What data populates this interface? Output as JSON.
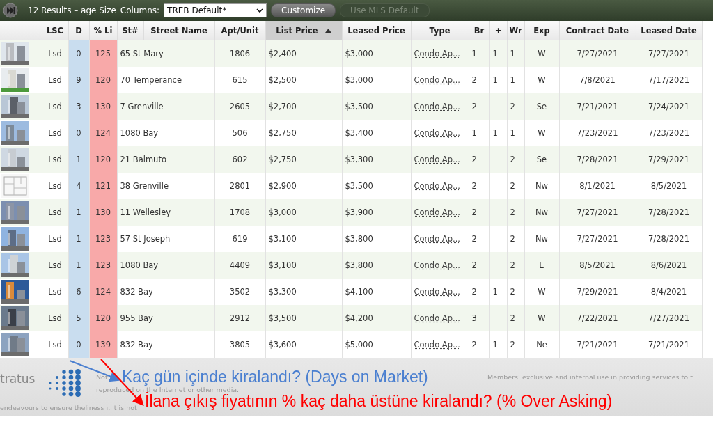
{
  "toolbar": {
    "results": "12 Results – age Size",
    "columns_label": "Columns:",
    "columns_value": "TREB Default*",
    "buttons": [
      {
        "label": "Customize",
        "disabled": false
      },
      {
        "label": "Use MLS Default",
        "disabled": true
      }
    ]
  },
  "table": {
    "columns": [
      {
        "label": "LSC",
        "sorted": false
      },
      {
        "label": "D",
        "sorted": false
      },
      {
        "label": "% Li",
        "sorted": false
      },
      {
        "label": "St#",
        "sorted": false
      },
      {
        "label": "Street Name",
        "sorted": false
      },
      {
        "label": "Apt/Unit",
        "sorted": false
      },
      {
        "label": "List Price",
        "sorted": true
      },
      {
        "label": "Leased Price",
        "sorted": false
      },
      {
        "label": "Type",
        "sorted": false
      },
      {
        "label": "Br",
        "sorted": false
      },
      {
        "label": "+",
        "sorted": false
      },
      {
        "label": "Wr",
        "sorted": false
      },
      {
        "label": "Exp",
        "sorted": false
      },
      {
        "label": "Contract Date",
        "sorted": false
      },
      {
        "label": "Leased Date",
        "sorted": false
      }
    ],
    "rows": [
      {
        "lsc": "Lsd",
        "d": "0",
        "pct": "125",
        "street": "65 St Mary",
        "apt": "1806",
        "list": "$2,400",
        "leased": "$3,000",
        "type": "Condo Ap...",
        "br": "1",
        "plus": "1",
        "wr": "1",
        "exp": "W",
        "contract": "7/27/2021",
        "leased_date": "7/27/2021"
      },
      {
        "lsc": "Lsd",
        "d": "9",
        "pct": "120",
        "street": "70 Temperance",
        "apt": "615",
        "list": "$2,500",
        "leased": "$3,000",
        "type": "Condo Ap...",
        "br": "2",
        "plus": "1",
        "wr": "1",
        "exp": "W",
        "contract": "7/8/2021",
        "leased_date": "7/17/2021"
      },
      {
        "lsc": "Lsd",
        "d": "3",
        "pct": "130",
        "street": "7 Grenville",
        "apt": "2605",
        "list": "$2,700",
        "leased": "$3,500",
        "type": "Condo Ap...",
        "br": "2",
        "wr": "2",
        "exp": "Se",
        "contract": "7/21/2021",
        "leased_date": "7/24/2021"
      },
      {
        "lsc": "Lsd",
        "d": "0",
        "pct": "124",
        "street": "1080 Bay",
        "apt": "506",
        "list": "$2,750",
        "leased": "$3,400",
        "type": "Condo Ap...",
        "br": "1",
        "plus": "1",
        "wr": "1",
        "exp": "W",
        "contract": "7/23/2021",
        "leased_date": "7/23/2021"
      },
      {
        "lsc": "Lsd",
        "d": "1",
        "pct": "120",
        "street": "21 Balmuto",
        "apt": "602",
        "list": "$2,750",
        "leased": "$3,300",
        "type": "Condo Ap...",
        "br": "2",
        "wr": "2",
        "exp": "Se",
        "contract": "7/28/2021",
        "leased_date": "7/29/2021"
      },
      {
        "lsc": "Lsd",
        "d": "4",
        "pct": "121",
        "street": "38 Grenville",
        "apt": "2801",
        "list": "$2,900",
        "leased": "$3,500",
        "type": "Condo Ap...",
        "br": "2",
        "wr": "2",
        "exp": "Nw",
        "contract": "8/1/2021",
        "leased_date": "8/5/2021"
      },
      {
        "lsc": "Lsd",
        "d": "1",
        "pct": "130",
        "street": "11 Wellesley",
        "apt": "1708",
        "list": "$3,000",
        "leased": "$3,900",
        "type": "Condo Ap...",
        "br": "2",
        "wr": "2",
        "exp": "Nw",
        "contract": "7/27/2021",
        "leased_date": "7/28/2021"
      },
      {
        "lsc": "Lsd",
        "d": "1",
        "pct": "123",
        "street": "57 St Joseph",
        "apt": "619",
        "list": "$3,100",
        "leased": "$3,800",
        "type": "Condo Ap...",
        "br": "2",
        "wr": "2",
        "exp": "Nw",
        "contract": "7/27/2021",
        "leased_date": "7/28/2021"
      },
      {
        "lsc": "Lsd",
        "d": "1",
        "pct": "123",
        "street": "1080 Bay",
        "apt": "4409",
        "list": "$3,100",
        "leased": "$3,800",
        "type": "Condo Ap...",
        "br": "2",
        "wr": "2",
        "exp": "E",
        "contract": "8/5/2021",
        "leased_date": "8/6/2021"
      },
      {
        "lsc": "Lsd",
        "d": "6",
        "pct": "124",
        "street": "832 Bay",
        "apt": "3502",
        "list": "$3,300",
        "leased": "$4,100",
        "type": "Condo Ap...",
        "br": "2",
        "plus": "1",
        "wr": "2",
        "exp": "W",
        "contract": "7/29/2021",
        "leased_date": "8/4/2021"
      },
      {
        "lsc": "Lsd",
        "d": "5",
        "pct": "120",
        "street": "955 Bay",
        "apt": "2912",
        "list": "$3,500",
        "leased": "$4,200",
        "type": "Condo Ap...",
        "br": "3",
        "wr": "2",
        "exp": "W",
        "contract": "7/22/2021",
        "leased_date": "7/27/2021"
      },
      {
        "lsc": "Lsd",
        "d": "0",
        "pct": "139",
        "street": "832 Bay",
        "apt": "3805",
        "list": "$3,600",
        "leased": "$5,000",
        "type": "Condo Ap...",
        "br": "2",
        "plus": "1",
        "wr": "2",
        "exp": "Ne",
        "contract": "7/21/2021",
        "leased_date": "7/21/2021"
      }
    ]
  },
  "footer": {
    "logo_text": "tratus",
    "lines": [
      "Not",
      "Members’ exclusive and internal use in providing services to t",
      "reproduced on the Internet or other media.",
      "endeavours to ensure theliness ı, it is not"
    ]
  },
  "annotations": [
    {
      "text": "Kaç gün içinde kiralandı? (Days on Market)",
      "color": "#4a7fd0"
    },
    {
      "text": "İlana çıkış fiyatının % kaç daha üstüne kiralandı? (% Over Asking)",
      "color": "#ff0000"
    }
  ]
}
